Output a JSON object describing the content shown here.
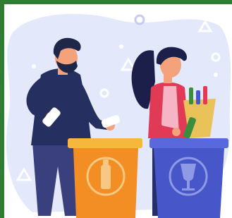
{
  "scene": {
    "description_icons": [
      "recycle-icon",
      "bottle-icon",
      "glass-icon"
    ],
    "colors": {
      "frame": "#2f7d32",
      "backdrop": "#e4e8fb",
      "backdrop_dots": "#ffffff",
      "orange_bin": "#f28e24",
      "orange_bin_lid": "#f6b83b",
      "blue_bin": "#4756c9",
      "blue_bin_lid": "#5968dc",
      "man_sweater": "#253060",
      "man_pants": "#39407d",
      "man_hair": "#1f2749",
      "woman_hair": "#1b1f4a",
      "woman_top": "#e03a56",
      "woman_pants": "#262e6a",
      "skin": "#f3a27c",
      "bag": "#e9c25a",
      "bottle_green": "#3b8d3e"
    }
  }
}
